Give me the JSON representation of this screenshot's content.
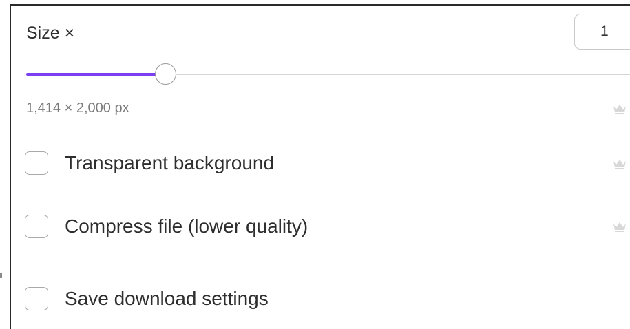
{
  "size": {
    "label": "Size ×",
    "value": "1",
    "slider_fraction": 0.23,
    "dimensions": "1,414 × 2,000 px"
  },
  "options": [
    {
      "label": "Transparent background",
      "checked": false,
      "premium_icon": "crown-icon"
    },
    {
      "label": "Compress file (lower quality)",
      "checked": false,
      "premium_icon": "crown-icon"
    },
    {
      "label": "Save download settings",
      "checked": false
    }
  ],
  "colors": {
    "accent": "#7b3ff2",
    "premium_icon": "#d8d8d8"
  }
}
